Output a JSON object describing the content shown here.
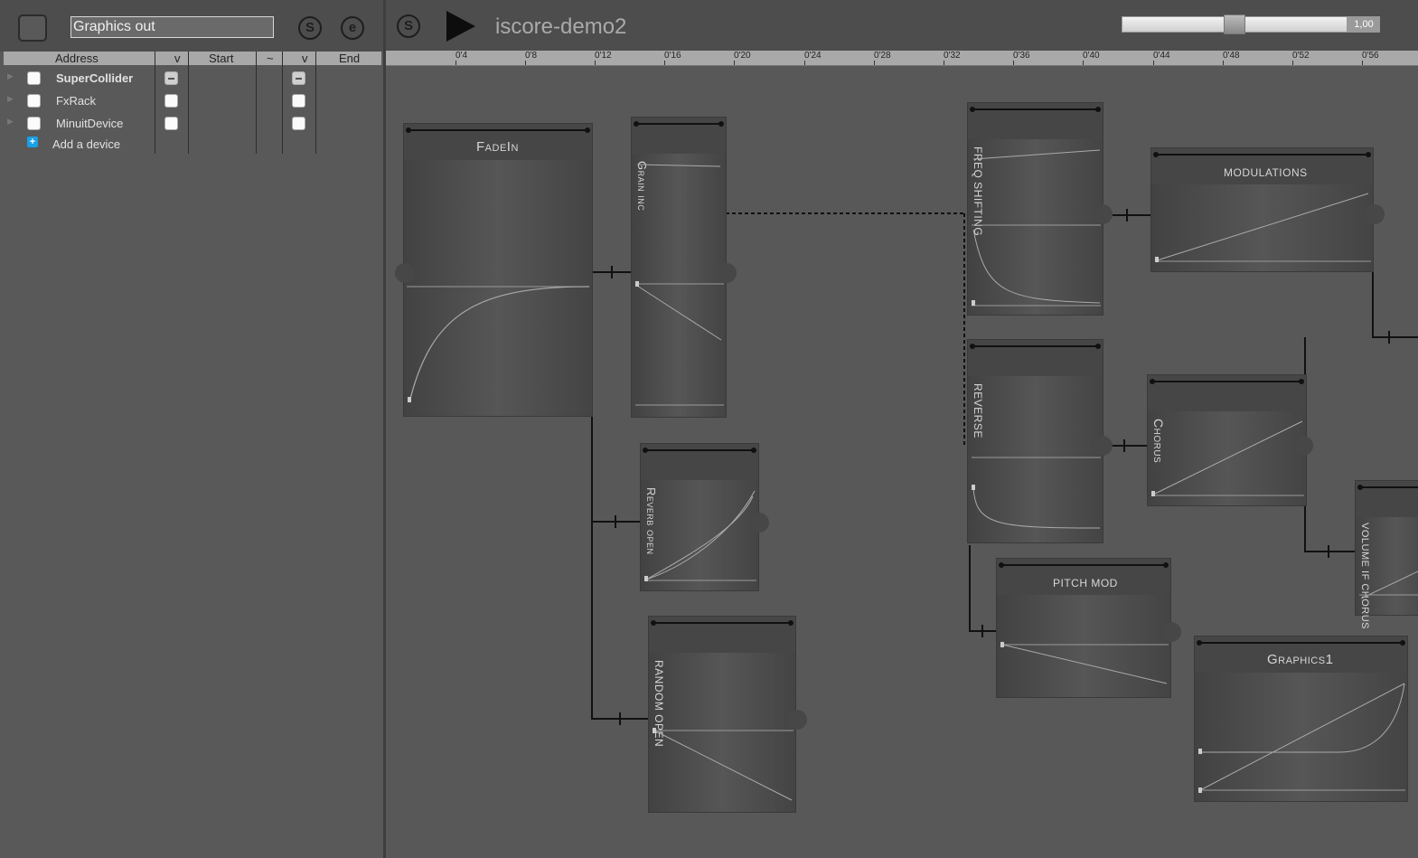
{
  "inspector": {
    "name_field": "Graphics out",
    "start_btn": "S",
    "end_btn": "e",
    "columns": {
      "address": "Address",
      "v1": "v",
      "start": "Start",
      "tilde": "~",
      "v2": "v",
      "end": "End"
    },
    "devices": [
      {
        "label": "SuperCollider",
        "bold": true,
        "start_state": "mixed",
        "end_state": "mixed"
      },
      {
        "label": "FxRack",
        "bold": false,
        "start_state": "off",
        "end_state": "off"
      },
      {
        "label": "MinuitDevice",
        "bold": false,
        "start_state": "off",
        "end_state": "off"
      }
    ],
    "add_device": "Add a device"
  },
  "transport": {
    "sync_btn": "S",
    "title": "iscore-demo2",
    "zoom_value": "1,00",
    "zoom_level": 0.5
  },
  "ruler": {
    "ticks": [
      "0'4",
      "0'8",
      "0'12",
      "0'16",
      "0'20",
      "0'24",
      "0'28",
      "0'32",
      "0'36",
      "0'40",
      "0'44",
      "0'48",
      "0'52",
      "0'56"
    ]
  },
  "boxes": {
    "fadein": "FadeIn",
    "grain_inc": "Grain inc",
    "freq_shifting": "FREQ SHIFTING",
    "modulations": "MODULATIONS",
    "reverse": "REVERSE",
    "chorus": "Chorus",
    "reverb_open": "Reverb open",
    "random_open": "RANDOM OPEN",
    "pitch_mod": "PITCH MOD",
    "volume_if_chorus": "VOLUME IF CHORUS",
    "graphics1": "Graphics1"
  },
  "colors": {
    "background": "#585858",
    "toolbar": "#4d4d4d",
    "ruler": "#a9a9a9",
    "accent_add": "#1aa0e8"
  }
}
